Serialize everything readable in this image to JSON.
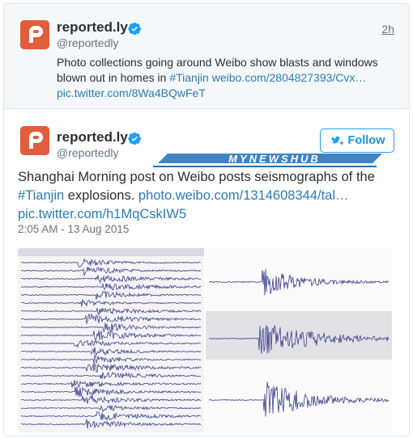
{
  "top_tweet": {
    "display_name": "reported.ly",
    "handle": "@reportedly",
    "time_ago": "2h",
    "text_line1": "Photo collections going around Weibo show blasts and windows",
    "text_line2_pre": "blown out in homes in ",
    "hashtag": "#Tianjin",
    "link": "weibo.com/2804827393/Cvx…",
    "pic_link": "pic.twitter.com/8Wa4BQwFeT"
  },
  "main_tweet": {
    "display_name": "reported.ly",
    "handle": "@reportedly",
    "follow_label": "Follow",
    "text_line1": "Shanghai Morning post on Weibo posts seismographs of the",
    "hashtag": "#Tianjin",
    "text_line2_mid": " explosions. ",
    "link": "photo.weibo.com/1314608344/tal…",
    "pic_link": "pic.twitter.com/h1MqCskIW5",
    "timestamp": "2:05 AM - 13 Aug 2015"
  },
  "watermark_text": "MYNEWSHUB",
  "colors": {
    "accent": "#1da1f2",
    "link": "#2b7bb9",
    "avatar": "#e15d3c",
    "trace": "#3b3f8c"
  },
  "icons": {
    "verified": "verified-badge-icon",
    "follow": "bird-plus-icon",
    "avatar": "reportedly-logo-icon"
  }
}
